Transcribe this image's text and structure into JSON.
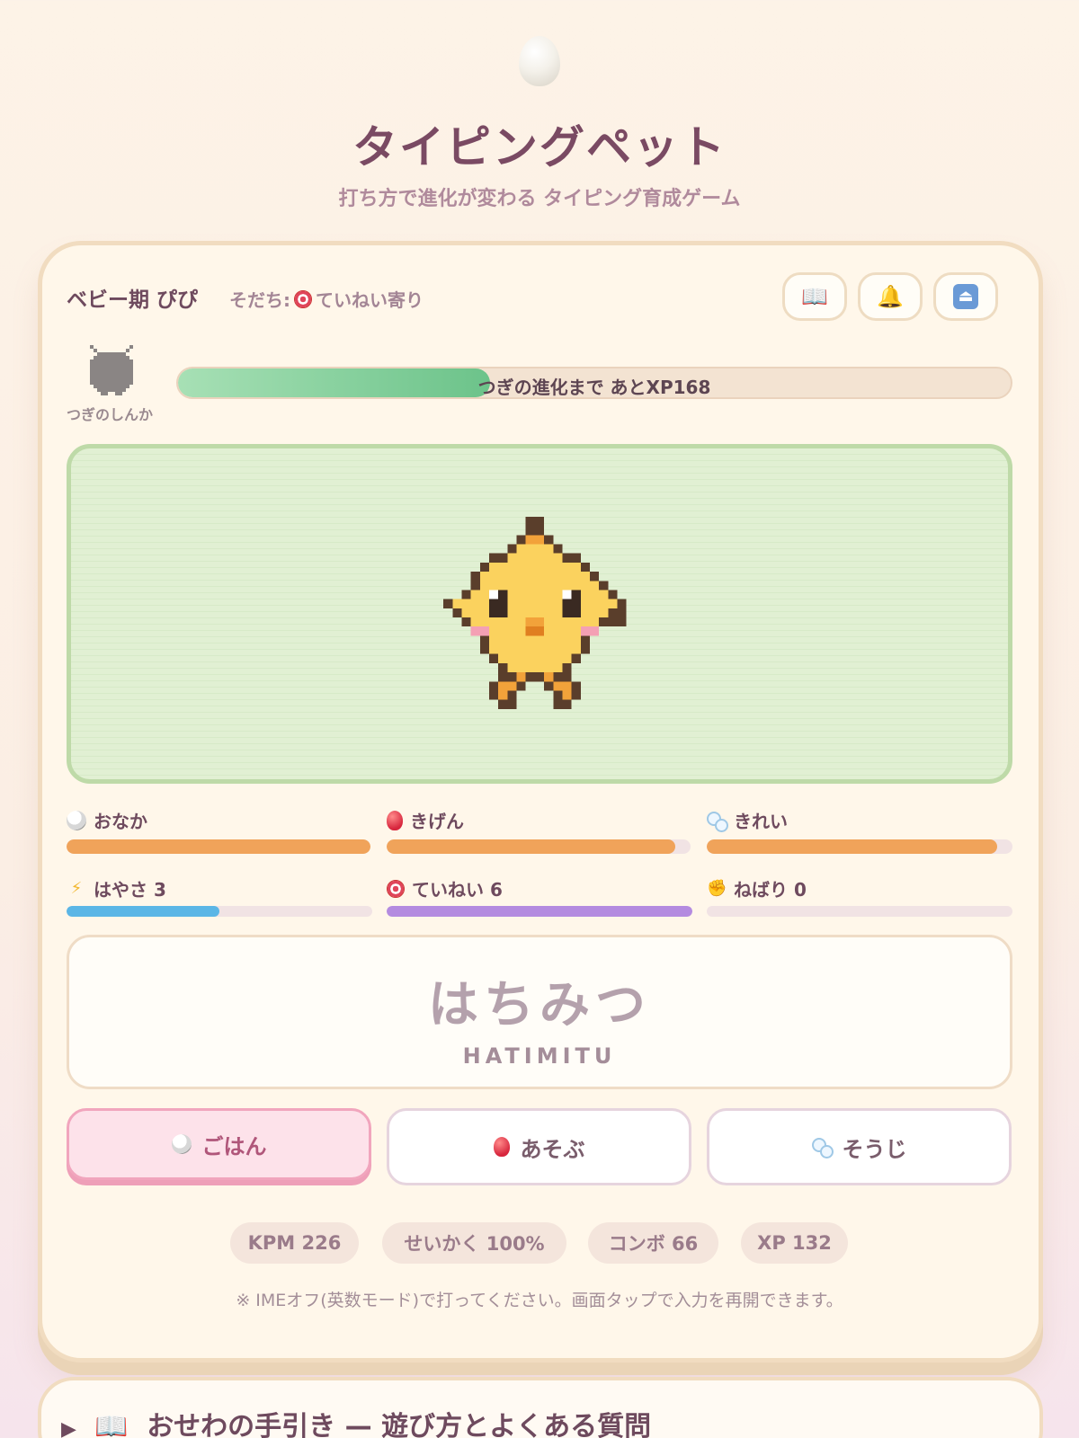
{
  "app": {
    "title": "タイピングペット",
    "subtitle": "打ち方で進化が変わる タイピング育成ゲーム"
  },
  "header": {
    "stage_name": "ベビー期 ぴぴ",
    "trait_label": "そだち:",
    "trait_value": "ていねい寄り",
    "buttons": [
      {
        "icon": "book-icon",
        "glyph": "📖"
      },
      {
        "icon": "bell-icon",
        "glyph": "🔔"
      },
      {
        "icon": "eject-icon",
        "glyph": "⏏"
      }
    ]
  },
  "evolution": {
    "next_label": "つぎのしんか",
    "xp_text": "つぎの進化まで あとXP168",
    "progress": 0.375
  },
  "stats": {
    "onaka": {
      "label": "おなか",
      "level": 1.0,
      "color": "#f0a35a"
    },
    "kigen": {
      "label": "きげん",
      "level": 0.95,
      "color": "#f0a35a"
    },
    "kirei": {
      "label": "きれい",
      "level": 0.95,
      "color": "#f0a35a"
    }
  },
  "traits": {
    "hayasa": {
      "label": "はやさ 3",
      "level": 0.5,
      "color": "#5bb6e6"
    },
    "teinei": {
      "label": "ていねい 6",
      "level": 1.0,
      "color": "#b48be0"
    },
    "nebari": {
      "label": "ねばり 0",
      "level": 0.0,
      "color": "#e6d3ea"
    }
  },
  "word": {
    "kana": "はちみつ",
    "romaji": "HATIMITU"
  },
  "actions": [
    {
      "label": "ごはん",
      "icon": "rice-bowl-icon",
      "active": true
    },
    {
      "label": "あそぶ",
      "icon": "balloon-icon",
      "active": false
    },
    {
      "label": "そうじ",
      "icon": "bubbles-icon",
      "active": false
    }
  ],
  "metrics": {
    "kpm": "KPM 226",
    "accuracy": "せいかく 100%",
    "combo": "コンボ 66",
    "xp": "XP 132"
  },
  "note": "※ IMEオフ(英数モード)で打ってください。画面タップで入力を再開できます。",
  "faq": {
    "arrow": "▶",
    "icon": "📖",
    "title": "おせわの手引き — 遊び方とよくある質問"
  }
}
